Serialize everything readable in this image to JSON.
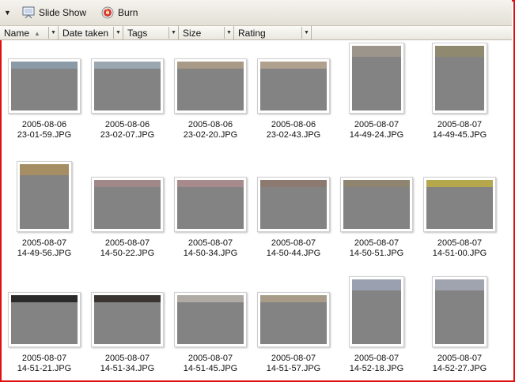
{
  "toolbar": {
    "slideshow_label": "Slide Show",
    "burn_label": "Burn"
  },
  "columns": [
    {
      "label": "Name",
      "sorted": true
    },
    {
      "label": "Date taken"
    },
    {
      "label": "Tags"
    },
    {
      "label": "Size"
    },
    {
      "label": "Rating"
    }
  ],
  "files": [
    {
      "line1": "2005-08-06",
      "line2": "23-01-59.JPG",
      "orientation": "landscape",
      "tint": "#8a9aa6"
    },
    {
      "line1": "2005-08-06",
      "line2": "23-02-07.JPG",
      "orientation": "landscape",
      "tint": "#9aa7b0"
    },
    {
      "line1": "2005-08-06",
      "line2": "23-02-20.JPG",
      "orientation": "landscape",
      "tint": "#a89a86"
    },
    {
      "line1": "2005-08-06",
      "line2": "23-02-43.JPG",
      "orientation": "landscape",
      "tint": "#b0a18e"
    },
    {
      "line1": "2005-08-07",
      "line2": "14-49-24.JPG",
      "orientation": "portrait",
      "tint": "#9c958c"
    },
    {
      "line1": "2005-08-07",
      "line2": "14-49-45.JPG",
      "orientation": "portrait",
      "tint": "#8f8a6f"
    },
    {
      "line1": "2005-08-07",
      "line2": "14-49-56.JPG",
      "orientation": "portrait",
      "tint": "#a58e63"
    },
    {
      "line1": "2005-08-07",
      "line2": "14-50-22.JPG",
      "orientation": "landscape",
      "tint": "#a08888"
    },
    {
      "line1": "2005-08-07",
      "line2": "14-50-34.JPG",
      "orientation": "landscape",
      "tint": "#a78a8c"
    },
    {
      "line1": "2005-08-07",
      "line2": "14-50-44.JPG",
      "orientation": "landscape",
      "tint": "#8c7a70"
    },
    {
      "line1": "2005-08-07",
      "line2": "14-50-51.JPG",
      "orientation": "landscape",
      "tint": "#8e8470"
    },
    {
      "line1": "2005-08-07",
      "line2": "14-51-00.JPG",
      "orientation": "landscape",
      "tint": "#b5a84c"
    },
    {
      "line1": "2005-08-07",
      "line2": "14-51-21.JPG",
      "orientation": "landscape",
      "tint": "#2a2a2a"
    },
    {
      "line1": "2005-08-07",
      "line2": "14-51-34.JPG",
      "orientation": "landscape",
      "tint": "#3a3530"
    },
    {
      "line1": "2005-08-07",
      "line2": "14-51-45.JPG",
      "orientation": "landscape",
      "tint": "#b0aaa4"
    },
    {
      "line1": "2005-08-07",
      "line2": "14-51-57.JPG",
      "orientation": "landscape",
      "tint": "#a89c88"
    },
    {
      "line1": "2005-08-07",
      "line2": "14-52-18.JPG",
      "orientation": "portrait",
      "tint": "#9aa0b0"
    },
    {
      "line1": "2005-08-07",
      "line2": "14-52-27.JPG",
      "orientation": "portrait",
      "tint": "#a0a4ae"
    }
  ],
  "colors": {
    "frame": "#e01010",
    "placeholder": "#838383"
  }
}
